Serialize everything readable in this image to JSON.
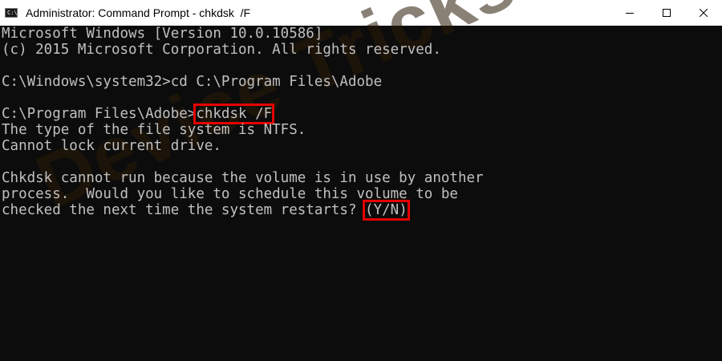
{
  "window": {
    "title": "Administrator: Command Prompt - chkdsk  /F",
    "icon_label": "C:\\"
  },
  "controls": {
    "minimize": "minimize-icon",
    "maximize": "maximize-icon",
    "close": "close-icon"
  },
  "console": {
    "lines": [
      "Microsoft Windows [Version 10.0.10586]",
      "(c) 2015 Microsoft Corporation. All rights reserved.",
      "",
      "C:\\Windows\\system32>cd C:\\Program Files\\Adobe",
      "",
      "C:\\Program Files\\Adobe>",
      "The type of the file system is NTFS.",
      "Cannot lock current drive.",
      "",
      "Chkdsk cannot run because the volume is in use by another",
      "process.  Would you like to schedule this volume to be",
      "checked the next time the system restarts? "
    ],
    "command": "chkdsk /F",
    "prompt_answer": "(Y/N)"
  },
  "watermark": {
    "text": "Device Tricks"
  },
  "colors": {
    "console_bg": "#0c0c0c",
    "console_text": "#c0c0c0",
    "highlight": "#e50000"
  }
}
